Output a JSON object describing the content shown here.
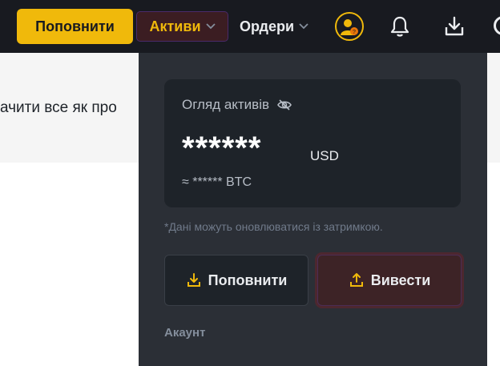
{
  "header": {
    "deposit_label": "Поповнити",
    "assets_label": "Активи",
    "orders_label": "Ордери"
  },
  "background": {
    "text": "ачити все як про"
  },
  "dropdown": {
    "overview_title": "Огляд активів",
    "balance_masked": "******",
    "balance_currency": "USD",
    "btc_line": "≈ ****** BTC",
    "note": "*Дані можуть оновлюватися із затримкою.",
    "deposit_button": "Поповнити",
    "withdraw_button": "Вивести",
    "account_label": "Акаунт"
  },
  "colors": {
    "brand_yellow": "#f0b90b",
    "header_bg": "#181a20",
    "panel_bg": "#2b2f36",
    "card_bg": "#1e2329"
  },
  "icons": [
    "chevron-down-icon",
    "avatar-icon",
    "bell-icon",
    "download-icon",
    "eye-slash-icon",
    "deposit-icon",
    "withdraw-icon"
  ]
}
